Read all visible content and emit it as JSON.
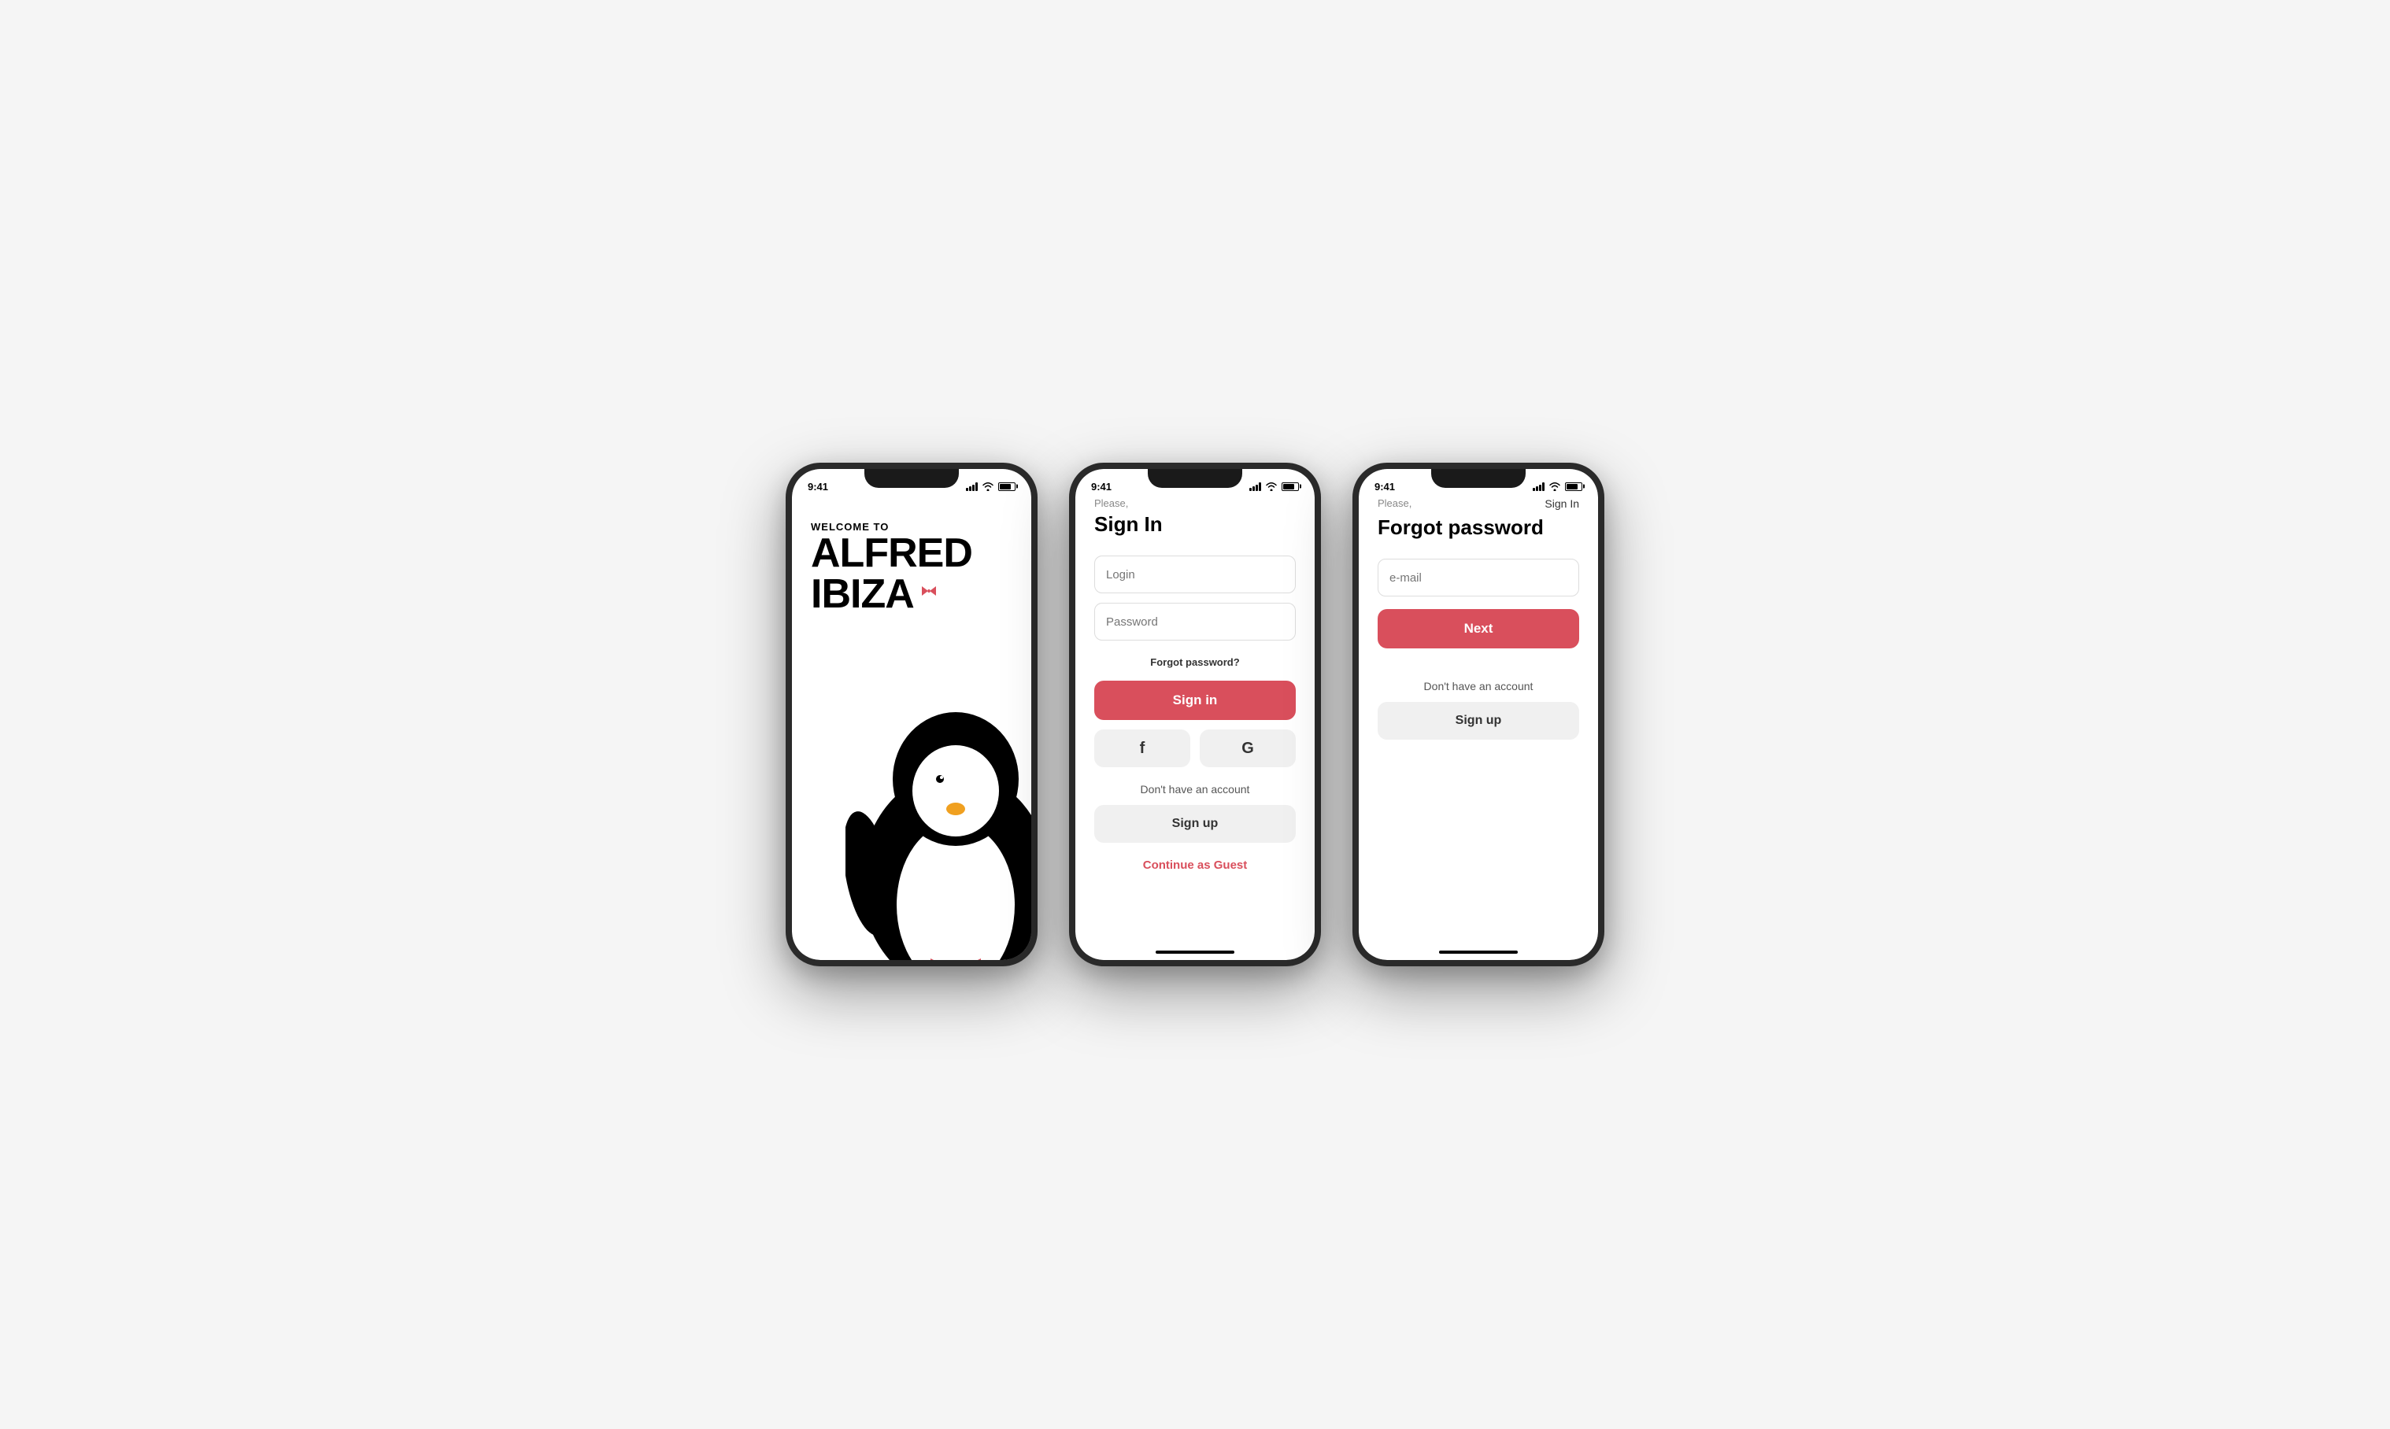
{
  "app": {
    "name": "Alfred Ibiza"
  },
  "phone1": {
    "status_time": "9:41",
    "welcome_label": "WELCOME TO",
    "app_name_line1": "ALFRED",
    "app_name_line2": "IBIZA"
  },
  "phone2": {
    "status_time": "9:41",
    "please_label": "Please,",
    "screen_title": "Sign In",
    "login_placeholder": "Login",
    "password_placeholder": "Password",
    "forgot_password_label": "Forgot password?",
    "sign_in_button": "Sign in",
    "facebook_icon": "f",
    "google_icon": "G",
    "dont_have_account": "Don't have an account",
    "sign_up_button": "Sign up",
    "continue_guest": "Continue as Guest"
  },
  "phone3": {
    "status_time": "9:41",
    "please_label": "Please,",
    "sign_in_link": "Sign In",
    "screen_title": "Forgot password",
    "email_placeholder": "e-mail",
    "next_button": "Next",
    "dont_have_account": "Don't have an account",
    "sign_up_button": "Sign up"
  },
  "colors": {
    "primary_red": "#d94f5c",
    "light_gray": "#f0f0f0",
    "border_gray": "#dddddd",
    "text_gray": "#888888",
    "dark_text": "#000000"
  }
}
